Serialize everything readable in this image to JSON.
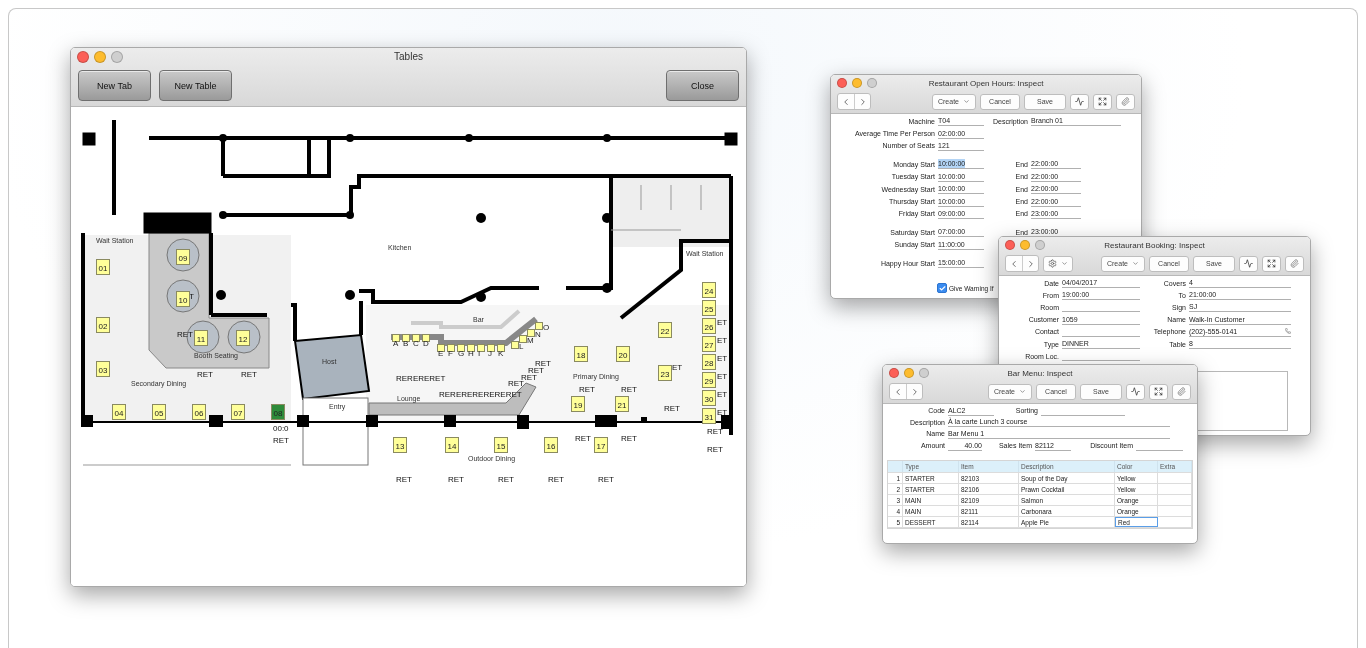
{
  "tables_window": {
    "title": "Tables",
    "buttons": [
      "New Tab",
      "New Table",
      "Close"
    ],
    "room_labels": [
      "Wait Station",
      "Kitchen",
      "Wait Station",
      "Bar",
      "Booth Seating",
      "Host",
      "Secondary Dining",
      "Entry",
      "Lounge",
      "Primary Dining",
      "Outdoor Dining"
    ],
    "tables": [
      {
        "label": "01",
        "color": "#ffff99"
      },
      {
        "label": "02",
        "color": "#ffff99"
      },
      {
        "label": "03",
        "color": "#ffff99"
      },
      {
        "label": "04",
        "color": "#ffff99"
      },
      {
        "label": "05",
        "color": "#ffff99"
      },
      {
        "label": "06",
        "color": "#ffff99"
      },
      {
        "label": "07",
        "color": "#ffff99"
      },
      {
        "label": "08",
        "color": "#2e8b3a"
      },
      {
        "label": "09",
        "color": "#ffff99"
      },
      {
        "label": "10",
        "color": "#ffff99"
      },
      {
        "label": "11",
        "color": "#ffff99"
      },
      {
        "label": "12",
        "color": "#ffff99"
      },
      {
        "label": "13",
        "color": "#ffff99"
      },
      {
        "label": "14",
        "color": "#ffff99"
      },
      {
        "label": "15",
        "color": "#ffff99"
      },
      {
        "label": "16",
        "color": "#ffff99"
      },
      {
        "label": "17",
        "color": "#ffff99"
      },
      {
        "label": "18",
        "color": "#ffff99"
      },
      {
        "label": "19",
        "color": "#ffff99"
      },
      {
        "label": "20",
        "color": "#ffff99"
      },
      {
        "label": "21",
        "color": "#ffff99"
      },
      {
        "label": "22",
        "color": "#ffff99"
      },
      {
        "label": "23",
        "color": "#ffff99"
      },
      {
        "label": "24",
        "color": "#ffff99"
      },
      {
        "label": "25",
        "color": "#ffff99"
      },
      {
        "label": "26",
        "color": "#ffff99"
      },
      {
        "label": "27",
        "color": "#ffff99"
      },
      {
        "label": "28",
        "color": "#ffff99"
      },
      {
        "label": "29",
        "color": "#ffff99"
      },
      {
        "label": "30",
        "color": "#ffff99"
      },
      {
        "label": "31",
        "color": "#ffff99"
      }
    ],
    "bar_seats": [
      "A",
      "B",
      "C",
      "D",
      "E",
      "F",
      "G",
      "H",
      "I",
      "J",
      "K",
      "L",
      "M",
      "N",
      "O"
    ],
    "tags": [
      "T",
      "RET",
      "RET",
      "RET",
      "00:0",
      "RET",
      "RERERERET",
      "RERERERERERERET",
      "RET",
      "RET",
      "RET",
      "RET",
      "RET",
      "RET",
      "ET",
      "RET",
      "ET",
      "ET",
      "ET",
      "ET",
      "ET",
      "ET",
      "RET",
      "RET",
      "RET",
      "RET",
      "RET",
      "RET",
      "RET",
      "RET",
      "RET"
    ]
  },
  "open_hours": {
    "title": "Restaurant Open Hours: Inspect",
    "toolbar": {
      "create": "Create",
      "cancel": "Cancel",
      "save": "Save"
    },
    "sections": [
      [
        {
          "label": "Machine",
          "value": "T04",
          "selected": false,
          "right": {
            "label": "Description",
            "value": "Branch 01"
          }
        },
        {
          "label": "Average Time Per Person",
          "value": "02:00:00",
          "selected": false
        },
        {
          "label": "Number of Seats",
          "value": "121",
          "selected": false
        }
      ],
      [
        {
          "label": "Monday Start",
          "value": "10:00:00",
          "selected": true,
          "right": {
            "label": "End",
            "value": "22:00:00"
          }
        },
        {
          "label": "Tuesday Start",
          "value": "10:00:00",
          "selected": false,
          "right": {
            "label": "End",
            "value": "22:00:00"
          }
        },
        {
          "label": "Wednesday Start",
          "value": "10:00:00",
          "selected": false,
          "right": {
            "label": "End",
            "value": "22:00:00"
          }
        },
        {
          "label": "Thursday Start",
          "value": "10:00:00",
          "selected": false,
          "right": {
            "label": "End",
            "value": "22:00:00"
          }
        },
        {
          "label": "Friday Start",
          "value": "09:00:00",
          "selected": false,
          "right": {
            "label": "End",
            "value": "23:00:00"
          }
        }
      ],
      [
        {
          "label": "Saturday Start",
          "value": "07:00:00",
          "selected": false,
          "right": {
            "label": "End",
            "value": "23:00:00"
          }
        },
        {
          "label": "Sunday Start",
          "value": "11:00:00",
          "selected": false
        }
      ],
      [
        {
          "label": "Happy Hour Start",
          "value": "15:00:00",
          "selected": false
        }
      ]
    ],
    "checkbox": {
      "label": "Give Warning If",
      "checked": true
    }
  },
  "booking": {
    "title": "Restaurant Booking: Inspect",
    "toolbar": {
      "create": "Create",
      "cancel": "Cancel",
      "save": "Save",
      "gear_menu": true
    },
    "rows": [
      [
        {
          "label": "Date",
          "value": "04/04/2017"
        },
        {
          "label": "Covers",
          "value": "4"
        }
      ],
      [
        {
          "label": "From",
          "value": "19:00:00"
        },
        {
          "label": "To",
          "value": "21:00:00"
        }
      ],
      [
        {
          "label": "Room"
        },
        {
          "label": "Sign",
          "value": "SJ"
        }
      ],
      [
        {
          "label": "Customer",
          "value": "1059"
        },
        {
          "label": "Name",
          "value": "Walk-In Customer"
        }
      ],
      [
        {
          "label": "Contact"
        },
        {
          "label": "Telephone",
          "value": "(202)-555-0141",
          "kind": "phone"
        }
      ],
      [
        {
          "label": "Type",
          "value": "DINNER"
        },
        {
          "label": "Table",
          "value": "8"
        }
      ],
      [
        {
          "label": "Room Loc."
        }
      ]
    ]
  },
  "bar_menu": {
    "title": "Bar Menu: Inspect",
    "toolbar": {
      "create": "Create",
      "cancel": "Cancel",
      "save": "Save"
    },
    "rows": [
      [
        {
          "label": "Code",
          "value": "ALC2"
        },
        {
          "label": "Sorting"
        }
      ],
      [
        {
          "label": "Description",
          "value": "À la carte Lunch 3 course"
        }
      ],
      [
        {
          "label": "Name",
          "value": "Bar Menu 1"
        }
      ],
      [
        {
          "label": "Amount",
          "value": "40.00"
        },
        {
          "label": "Sales Item",
          "value": "82112"
        },
        {
          "label": "Discount Item"
        }
      ]
    ],
    "grid": {
      "columns": [
        "Type",
        "Item",
        "Description",
        "Color",
        "Extra"
      ],
      "rows": [
        {
          "number": "1",
          "cells": [
            "STARTER",
            "82103",
            "Soup of the Day",
            "Yellow"
          ],
          "selected": false
        },
        {
          "number": "2",
          "cells": [
            "STARTER",
            "82106",
            "Prawn Cocktail",
            "Yellow"
          ],
          "selected": false
        },
        {
          "number": "3",
          "cells": [
            "MAIN",
            "82109",
            "Salmon",
            "Orange"
          ],
          "selected": false
        },
        {
          "number": "4",
          "cells": [
            "MAIN",
            "82111",
            "Carbonara",
            "Orange"
          ],
          "selected": false
        },
        {
          "number": "5",
          "cells": [
            "DESSERT",
            "82114",
            "Apple Pie",
            "Red"
          ],
          "selected": true
        }
      ]
    }
  }
}
